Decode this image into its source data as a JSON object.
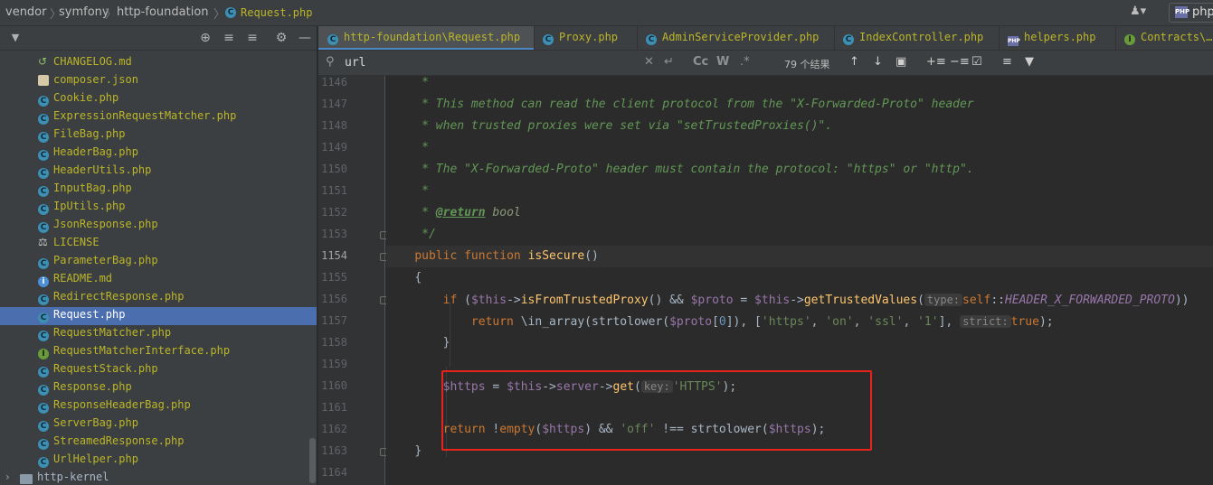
{
  "breadcrumb": [
    "vendor",
    "symfony",
    "http-foundation",
    "Request.php"
  ],
  "topright": {
    "php_label": "php"
  },
  "sidebar": {
    "items": [
      {
        "label": "CHANGELOG.md",
        "icon": "changelog-icon"
      },
      {
        "label": "composer.json",
        "icon": "composer-icon"
      },
      {
        "label": "Cookie.php",
        "icon": "class-icon"
      },
      {
        "label": "ExpressionRequestMatcher.php",
        "icon": "class-icon"
      },
      {
        "label": "FileBag.php",
        "icon": "class-icon"
      },
      {
        "label": "HeaderBag.php",
        "icon": "class-icon"
      },
      {
        "label": "HeaderUtils.php",
        "icon": "class-icon"
      },
      {
        "label": "InputBag.php",
        "icon": "class-icon"
      },
      {
        "label": "IpUtils.php",
        "icon": "class-icon"
      },
      {
        "label": "JsonResponse.php",
        "icon": "class-icon"
      },
      {
        "label": "LICENSE",
        "icon": "license-icon"
      },
      {
        "label": "ParameterBag.php",
        "icon": "class-icon"
      },
      {
        "label": "README.md",
        "icon": "info-icon"
      },
      {
        "label": "RedirectResponse.php",
        "icon": "class-icon"
      },
      {
        "label": "Request.php",
        "icon": "class-icon",
        "selected": true
      },
      {
        "label": "RequestMatcher.php",
        "icon": "class-icon"
      },
      {
        "label": "RequestMatcherInterface.php",
        "icon": "interface-icon"
      },
      {
        "label": "RequestStack.php",
        "icon": "class-icon"
      },
      {
        "label": "Response.php",
        "icon": "class-icon"
      },
      {
        "label": "ResponseHeaderBag.php",
        "icon": "class-icon"
      },
      {
        "label": "ServerBag.php",
        "icon": "class-icon"
      },
      {
        "label": "StreamedResponse.php",
        "icon": "class-icon"
      },
      {
        "label": "UrlHelper.php",
        "icon": "class-icon"
      }
    ],
    "folder": "http-kernel"
  },
  "tabs": [
    {
      "label": "http-foundation\\Request.php",
      "icon": "class-icon",
      "active": true
    },
    {
      "label": "Proxy.php",
      "icon": "class-icon"
    },
    {
      "label": "AdminServiceProvider.php",
      "icon": "class-icon"
    },
    {
      "label": "IndexController.php",
      "icon": "class-icon"
    },
    {
      "label": "helpers.php",
      "icon": "php-file-icon"
    },
    {
      "label": "Contracts\\…",
      "icon": "interface-icon"
    }
  ],
  "search": {
    "value": "url",
    "match_count": "79 个结果",
    "case_label": "Cc",
    "word_label": "W",
    "regex_label": ".*"
  },
  "gutter": {
    "lines": [
      "1146",
      "1147",
      "1148",
      "1149",
      "1150",
      "1151",
      "1152",
      "1153",
      "1154",
      "1155",
      "1156",
      "1157",
      "1158",
      "1159",
      "1160",
      "1161",
      "1162",
      "1163",
      "1164"
    ],
    "current": "1154"
  },
  "code": {
    "l1146": "*",
    "l1147": "* This method can read the client protocol from the \"X-Forwarded-Proto\" header",
    "l1148": "* when trusted proxies were set via \"setTrustedProxies()\".",
    "l1149": "*",
    "l1150": "* The \"X-Forwarded-Proto\" header must contain the protocol: \"https\" or \"http\".",
    "l1151": "*",
    "l1152_star": "* ",
    "l1152_tag": "@return",
    "l1152_type": " bool",
    "l1153": "*/",
    "kw_public": "public",
    "kw_function": "function",
    "fn_isSecure": "isSecure",
    "parens": "()",
    "brace_open": "{",
    "kw_if": "if",
    "this": "$this",
    "arrow": "->",
    "fn_isFromTrustedProxy": "isFromTrustedProxy",
    "andand": "&&",
    "var_proto": "$proto",
    "fn_getTrustedValues": "getTrustedValues",
    "hint_type": "type:",
    "kw_self": "self",
    "const_header": "HEADER_X_FORWARDED_PROTO",
    "kw_return": "return",
    "fn_in_array": "\\in_array",
    "fn_strtolower": "strtolower",
    "str_https": "'https'",
    "str_on": "'on'",
    "str_ssl": "'ssl'",
    "str_1": "'1'",
    "hint_strict": "strict:",
    "kw_true": "true",
    "brace_close": "}",
    "var_https": "$https",
    "kw_server": "server",
    "fn_get": "get",
    "hint_key": "key:",
    "str_HTTPS": "'HTTPS'",
    "fn_empty": "empty",
    "str_off": "'off'",
    "neq": "!=="
  },
  "colors": {
    "highlight_box": "#e8231b",
    "selection": "#4b6eaf"
  }
}
